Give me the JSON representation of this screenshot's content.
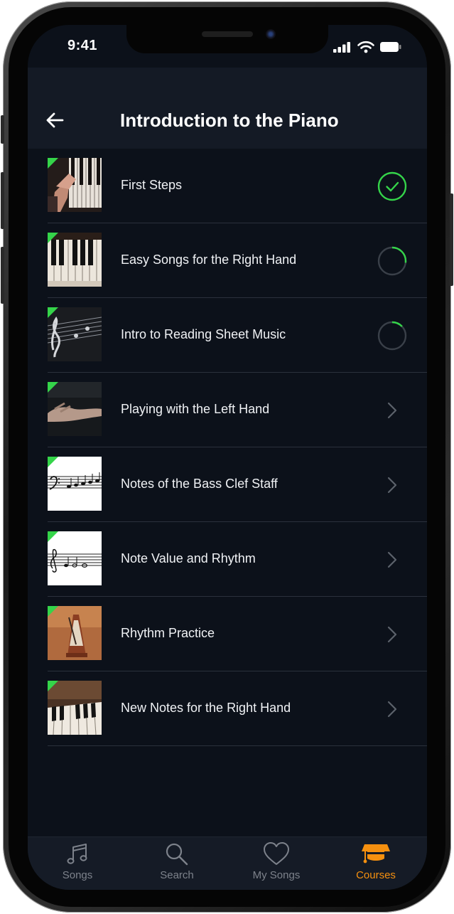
{
  "status_bar": {
    "time": "9:41"
  },
  "header": {
    "title": "Introduction to the Piano"
  },
  "lessons": [
    {
      "title": "First Steps",
      "status": "completed",
      "progress": 1.0
    },
    {
      "title": "Easy Songs for the Right Hand",
      "status": "in-progress",
      "progress": 0.27
    },
    {
      "title": "Intro to Reading Sheet Music",
      "status": "in-progress",
      "progress": 0.13
    },
    {
      "title": "Playing with the Left Hand",
      "status": "not-started"
    },
    {
      "title": "Notes of the Bass Clef Staff",
      "status": "not-started"
    },
    {
      "title": "Note Value and Rhythm",
      "status": "not-started"
    },
    {
      "title": "Rhythm Practice",
      "status": "not-started"
    },
    {
      "title": "New Notes for the Right Hand",
      "status": "not-started"
    }
  ],
  "tabs": [
    {
      "label": "Songs",
      "icon": "music-note-icon",
      "active": false
    },
    {
      "label": "Search",
      "icon": "search-icon",
      "active": false
    },
    {
      "label": "My Songs",
      "icon": "heart-icon",
      "active": false
    },
    {
      "label": "Courses",
      "icon": "graduation-cap-icon",
      "active": true
    }
  ],
  "colors": {
    "accent_green": "#35d44a",
    "accent_orange": "#f5900f",
    "background": "#0c111a",
    "header": "#141a25"
  }
}
